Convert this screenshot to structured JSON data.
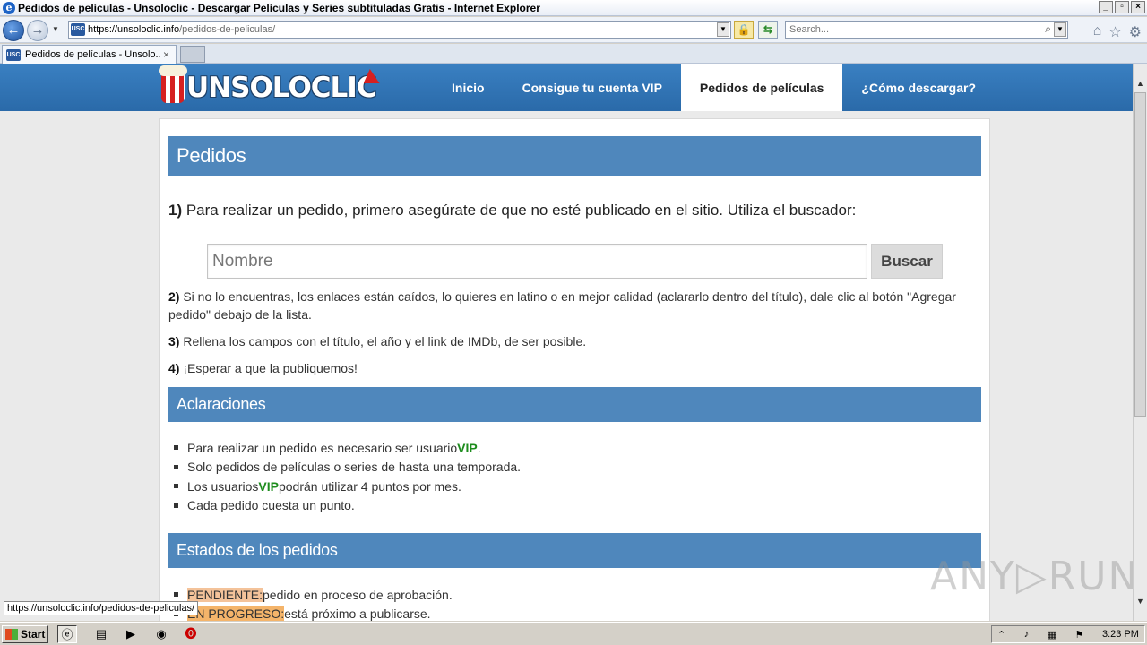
{
  "window": {
    "title": "Pedidos de películas - Unsoloclic - Descargar Películas y Series subtituladas Gratis - Internet Explorer",
    "minimize": "_",
    "restore": "▫",
    "close": "×"
  },
  "address": {
    "url_host": "https://unsoloclic.info",
    "url_path": "/pedidos-de-peliculas/",
    "favicon_text": "USC",
    "search_placeholder": "Search..."
  },
  "tabs": [
    {
      "label": "Pedidos de películas - Unsolo...",
      "favicon_text": "USC"
    }
  ],
  "site": {
    "logo_text": "UNSOLOCLIC",
    "nav": [
      {
        "label": "Inicio"
      },
      {
        "label": "Consigue tu cuenta VIP"
      },
      {
        "label": "Pedidos de películas",
        "active": true
      },
      {
        "label": "¿Cómo descargar?"
      }
    ]
  },
  "content": {
    "title_pedidos": "Pedidos",
    "step1_num": "1)",
    "step1_text": " Para realizar un pedido, primero asegúrate de que no esté publicado en el sitio. Utiliza el buscador:",
    "search_placeholder": "Nombre",
    "search_button": "Buscar",
    "step2_num": "2)",
    "step2_text": " Si no lo encuentras, los enlaces están caídos, lo quieres en latino o en mejor calidad (aclararlo dentro del título), dale clic al botón \"Agregar pedido\" debajo de la lista.",
    "step3_num": "3)",
    "step3_text": " Rellena los campos con el título, el año y el link de IMDb, de ser posible.",
    "step4_num": "4)",
    "step4_text": " ¡Esperar a que la publiquemos!",
    "title_aclaraciones": "Aclaraciones",
    "aclaraciones": {
      "item1_pre": "Para realizar un pedido es necesario ser usuario ",
      "item1_vip": "VIP",
      "item1_post": ".",
      "item2": "Solo pedidos de películas o series de hasta una temporada.",
      "item3_pre": "Los usuarios ",
      "item3_vip": "VIP",
      "item3_post": " podrán utilizar 4 puntos por mes.",
      "item4": "Cada pedido cuesta un punto."
    },
    "title_estados": "Estados de los pedidos",
    "estados": {
      "pend_label": "PENDIENTE:",
      "pend_text": " pedido en proceso de aprobación.",
      "prog_label": "EN PROGRESO:",
      "prog_text": " está próximo a publicarse."
    }
  },
  "watermark": "ANY▷RUN",
  "status_url": "https://unsoloclic.info/pedidos-de-peliculas/",
  "taskbar": {
    "start_label": "Start",
    "clock": "3:23 PM"
  }
}
